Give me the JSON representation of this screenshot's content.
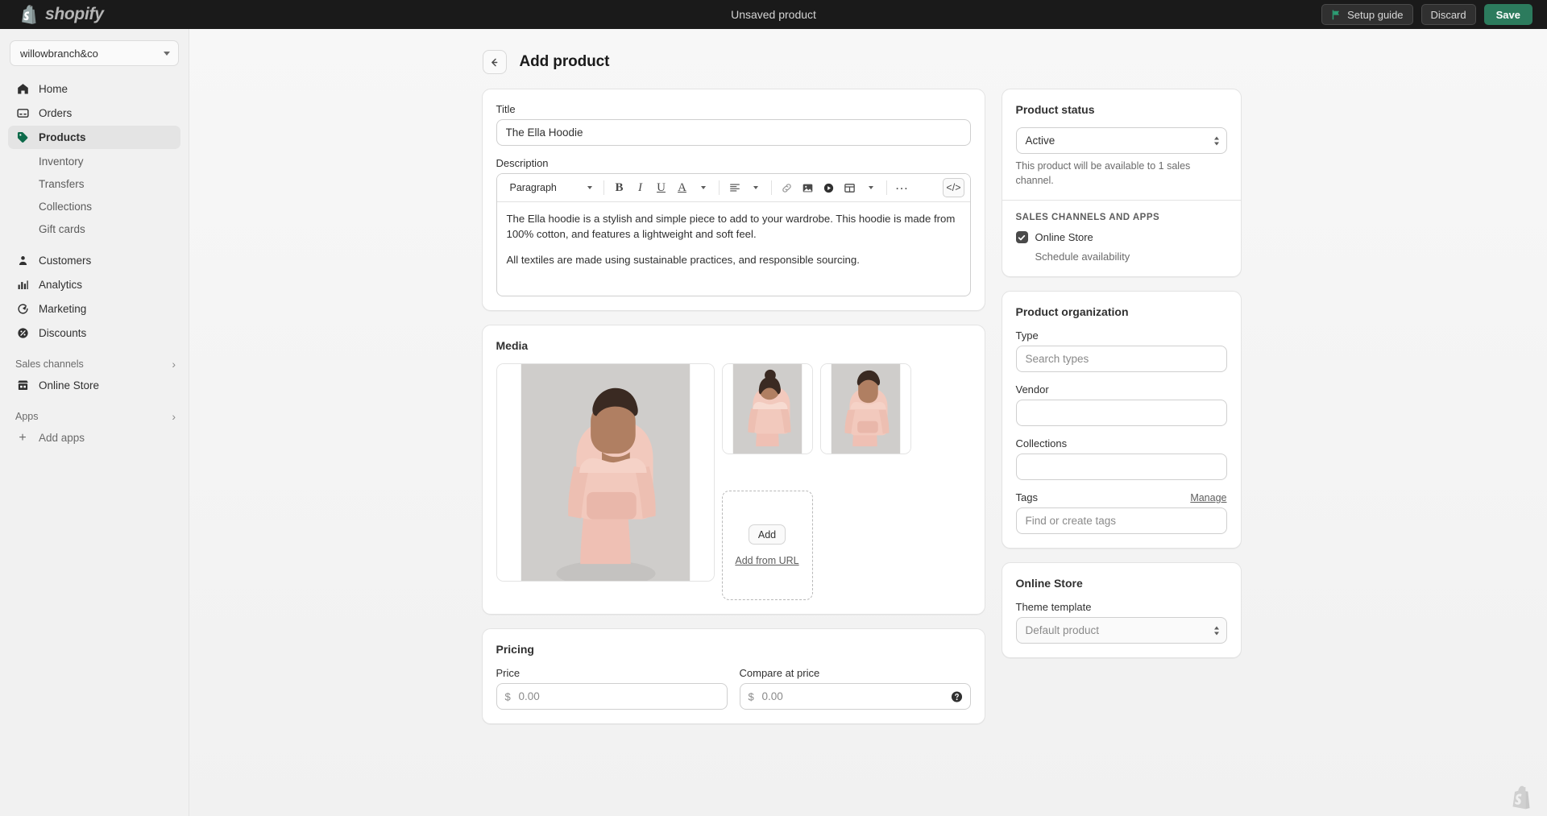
{
  "topbar": {
    "brand": "shopify",
    "brand_icon": "shopping-bag-icon",
    "title": "Unsaved product",
    "setup_guide": "Setup guide",
    "discard": "Discard",
    "save": "Save",
    "accent_green": "#2c7b5d",
    "background": "#1a1a1a"
  },
  "sidebar": {
    "store": "willowbranch&co",
    "items": [
      {
        "label": "Home",
        "icon": "home-icon"
      },
      {
        "label": "Orders",
        "icon": "orders-icon"
      },
      {
        "label": "Products",
        "icon": "products-tag-icon",
        "active": true
      },
      {
        "label": "Customers",
        "icon": "customers-icon"
      },
      {
        "label": "Analytics",
        "icon": "analytics-bars-icon"
      },
      {
        "label": "Marketing",
        "icon": "marketing-icon"
      },
      {
        "label": "Discounts",
        "icon": "discounts-icon"
      }
    ],
    "product_subitems": [
      "Inventory",
      "Transfers",
      "Collections",
      "Gift cards"
    ],
    "sales_channels_header": "Sales channels",
    "online_store": "Online Store",
    "apps_header": "Apps",
    "add_apps": "Add apps"
  },
  "page": {
    "title": "Add product",
    "back_icon": "arrow-left-icon"
  },
  "product": {
    "title_label": "Title",
    "title_value": "The Ella Hoodie",
    "description_label": "Description",
    "description_paragraphs": [
      "The Ella hoodie is a stylish and simple piece to add to your wardrobe. This hoodie is made from 100% cotton, and features a lightweight and soft feel.",
      "All textiles are made using sustainable practices, and responsible sourcing."
    ]
  },
  "editor_toolbar": {
    "format": "Paragraph",
    "bold": "B",
    "italic": "I",
    "underline": "U",
    "text_color": "A",
    "align_icon": "align-left-icon",
    "link_icon": "link-icon",
    "image_icon": "image-icon",
    "video_icon": "video-icon",
    "table_icon": "table-icon",
    "more": "…",
    "code": "</>"
  },
  "media": {
    "title": "Media",
    "add_button": "Add",
    "add_from_url": "Add from URL",
    "items": [
      {
        "name": "product-photo-front-full",
        "alt": "Model wearing pink hoodie, front view"
      },
      {
        "name": "product-photo-back",
        "alt": "Model wearing pink hoodie, back view"
      },
      {
        "name": "product-photo-side",
        "alt": "Model wearing pink hoodie, side view"
      }
    ]
  },
  "pricing": {
    "title": "Pricing",
    "price_label": "Price",
    "price_placeholder": "0.00",
    "compare_label": "Compare at price",
    "compare_placeholder": "0.00",
    "currency": "$",
    "help_icon": "help-circle-icon"
  },
  "product_status": {
    "title": "Product status",
    "status_value": "Active",
    "helper": "This product will be available to 1 sales channel.",
    "channels_header": "SALES CHANNELS AND APPS",
    "online_store": "Online Store",
    "schedule": "Schedule availability"
  },
  "product_organization": {
    "title": "Product organization",
    "type_label": "Type",
    "type_placeholder": "Search types",
    "vendor_label": "Vendor",
    "vendor_value": "",
    "collections_label": "Collections",
    "collections_value": "",
    "tags_label": "Tags",
    "tags_manage": "Manage",
    "tags_placeholder": "Find or create tags"
  },
  "online_store_card": {
    "title": "Online Store",
    "theme_label": "Theme template",
    "theme_value": "Default product"
  }
}
